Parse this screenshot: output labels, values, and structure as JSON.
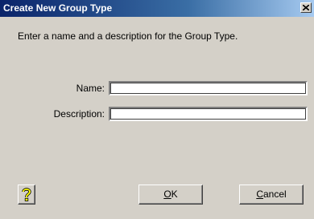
{
  "window": {
    "title": "Create New Group Type",
    "close_glyph": "✕"
  },
  "prompt": "Enter a name and a description for the Group Type.",
  "form": {
    "name_label": "Name:",
    "name_value": "",
    "description_label": "Description:",
    "description_value": ""
  },
  "buttons": {
    "help_icon": "question-mark-icon",
    "ok_mnemonic": "O",
    "ok_rest": "K",
    "cancel_mnemonic": "C",
    "cancel_rest": "ancel"
  },
  "colors": {
    "titlebar_start": "#0a246a",
    "titlebar_end": "#a6caf0",
    "dialog_background": "#d4d0c8",
    "help_icon_fill": "#ffff00"
  }
}
